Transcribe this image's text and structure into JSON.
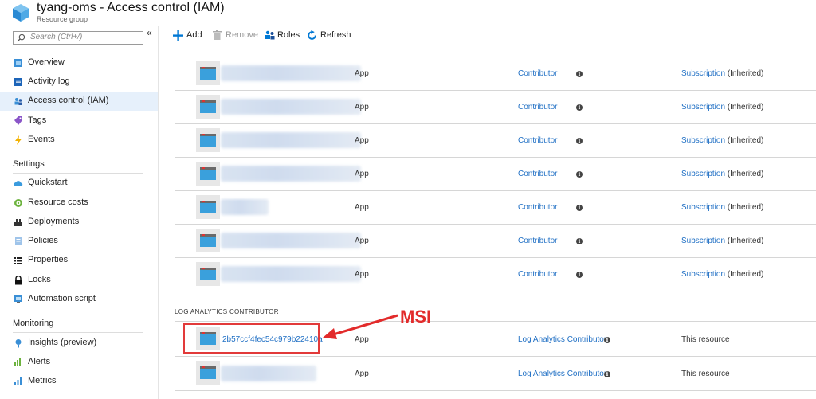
{
  "header": {
    "title": "tyang-oms - Access control (IAM)",
    "subtitle": "Resource group",
    "logo_icon": "resource-group-cube-icon"
  },
  "sidebar": {
    "search_placeholder": "Search (Ctrl+/)",
    "collapse_label": "«",
    "items": [
      {
        "label": "Overview",
        "icon": "overview-icon",
        "active": false
      },
      {
        "label": "Activity log",
        "icon": "activity-log-icon",
        "active": false
      },
      {
        "label": "Access control (IAM)",
        "icon": "iam-people-icon",
        "active": true
      },
      {
        "label": "Tags",
        "icon": "tag-icon",
        "active": false
      },
      {
        "label": "Events",
        "icon": "lightning-icon",
        "active": false
      }
    ],
    "settings_title": "Settings",
    "settings_items": [
      {
        "label": "Quickstart",
        "icon": "cloud-icon"
      },
      {
        "label": "Resource costs",
        "icon": "cost-icon"
      },
      {
        "label": "Deployments",
        "icon": "deployments-icon"
      },
      {
        "label": "Policies",
        "icon": "policies-icon"
      },
      {
        "label": "Properties",
        "icon": "properties-icon"
      },
      {
        "label": "Locks",
        "icon": "lock-icon"
      },
      {
        "label": "Automation script",
        "icon": "automation-script-icon"
      }
    ],
    "monitoring_title": "Monitoring",
    "monitoring_items": [
      {
        "label": "Insights (preview)",
        "icon": "insights-icon"
      },
      {
        "label": "Alerts",
        "icon": "alerts-icon"
      },
      {
        "label": "Metrics",
        "icon": "metrics-icon"
      }
    ]
  },
  "toolbar": {
    "add": "Add",
    "remove": "Remove",
    "roles": "Roles",
    "refresh": "Refresh"
  },
  "contributor_rows": [
    {
      "type": "App",
      "role": "Contributor",
      "scope": "Subscription",
      "scope_suffix": "(Inherited)"
    },
    {
      "type": "App",
      "role": "Contributor",
      "scope": "Subscription",
      "scope_suffix": "(Inherited)"
    },
    {
      "type": "App",
      "role": "Contributor",
      "scope": "Subscription",
      "scope_suffix": "(Inherited)"
    },
    {
      "type": "App",
      "role": "Contributor",
      "scope": "Subscription",
      "scope_suffix": "(Inherited)"
    },
    {
      "type": "App",
      "role": "Contributor",
      "scope": "Subscription",
      "scope_suffix": "(Inherited)"
    },
    {
      "type": "App",
      "role": "Contributor",
      "scope": "Subscription",
      "scope_suffix": "(Inherited)"
    },
    {
      "type": "App",
      "role": "Contributor",
      "scope": "Subscription",
      "scope_suffix": "(Inherited)"
    }
  ],
  "group_title": "LOG ANALYTICS CONTRIBUTOR",
  "la_rows": [
    {
      "name": "2b57ccf4fec54c979b22410a",
      "type": "App",
      "role": "Log Analytics Contributor",
      "scope": "This resource"
    },
    {
      "name": "",
      "type": "App",
      "role": "Log Analytics Contributor",
      "scope": "This resource"
    }
  ],
  "annotation": {
    "label": "MSI",
    "color": "#e22b2b"
  },
  "colors": {
    "link": "#1f6fc4",
    "active_nav": "#e6f0fb",
    "accent": "#0078d4"
  }
}
